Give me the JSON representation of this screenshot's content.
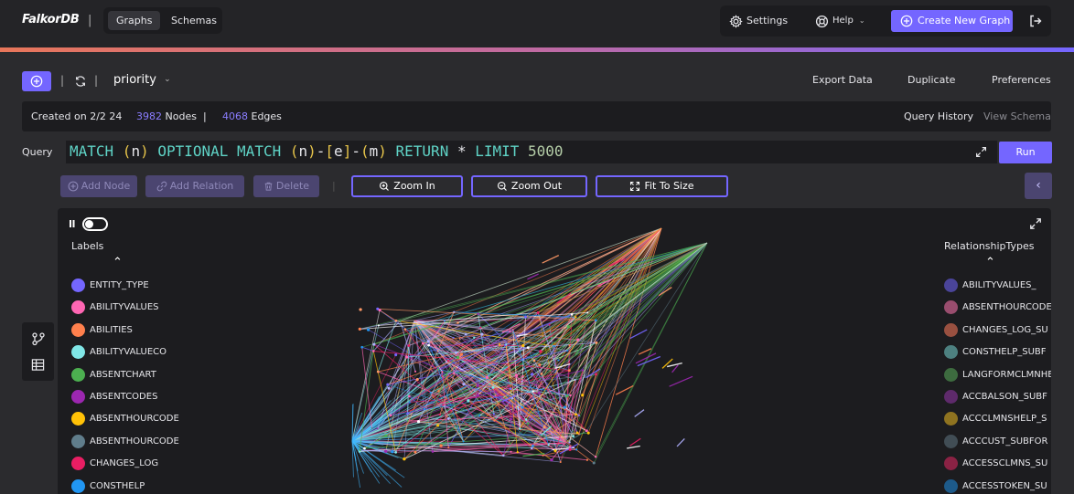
{
  "app": {
    "logo": "FalkorDB"
  },
  "nav": {
    "tabs": [
      {
        "label": "Graphs",
        "active": true
      },
      {
        "label": "Schemas",
        "active": false
      }
    ],
    "settings_label": "Settings",
    "help_label": "Help",
    "create_label": "Create New Graph"
  },
  "graph": {
    "name": "priority",
    "export_label": "Export Data",
    "duplicate_label": "Duplicate",
    "preferences_label": "Preferences"
  },
  "info": {
    "created_label": "Created on 2/2 24",
    "nodes_count": "3982",
    "nodes_label": "Nodes",
    "divider": "|",
    "edges_count": "4068",
    "edges_label": "Edges",
    "query_history_label": "Query History",
    "view_schema_label": "View Schema"
  },
  "query": {
    "label": "Query",
    "tokens": [
      {
        "t": "MATCH ",
        "c": "#5fd3c6"
      },
      {
        "t": "(",
        "c": "#e6c44a"
      },
      {
        "t": "n",
        "c": "#e6e6ea"
      },
      {
        "t": ")",
        "c": "#e6c44a"
      },
      {
        "t": " OPTIONAL MATCH ",
        "c": "#5fd3c6"
      },
      {
        "t": "(",
        "c": "#e6c44a"
      },
      {
        "t": "n",
        "c": "#e6e6ea"
      },
      {
        "t": ")",
        "c": "#e6c44a"
      },
      {
        "t": "-",
        "c": "#e6e6ea"
      },
      {
        "t": "[",
        "c": "#e6c44a"
      },
      {
        "t": "e",
        "c": "#e6e6ea"
      },
      {
        "t": "]",
        "c": "#e6c44a"
      },
      {
        "t": "-",
        "c": "#e6e6ea"
      },
      {
        "t": "(",
        "c": "#e6c44a"
      },
      {
        "t": "m",
        "c": "#e6e6ea"
      },
      {
        "t": ")",
        "c": "#e6c44a"
      },
      {
        "t": " RETURN ",
        "c": "#5fd3c6"
      },
      {
        "t": "* ",
        "c": "#e6e6ea"
      },
      {
        "t": "LIMIT ",
        "c": "#5fd3c6"
      },
      {
        "t": "5000",
        "c": "#b5cea8"
      }
    ],
    "run_label": "Run"
  },
  "actions": {
    "add_node": "Add Node",
    "add_relation": "Add Relation",
    "delete": "Delete",
    "zoom_in": "Zoom In",
    "zoom_out": "Zoom Out",
    "fit": "Fit To Size"
  },
  "legend": {
    "labels_title": "Labels",
    "labels": [
      {
        "name": "ENTITY_TYPE",
        "color": "#7466ff"
      },
      {
        "name": "ABILITYVALUES",
        "color": "#ff66b3"
      },
      {
        "name": "ABILITIES",
        "color": "#ff804d"
      },
      {
        "name": "ABILITYVALUECO",
        "color": "#80e6e6"
      },
      {
        "name": "ABSENTCHART",
        "color": "#4caf50"
      },
      {
        "name": "ABSENTCODES",
        "color": "#9c27b0"
      },
      {
        "name": "ABSENTHOURCODE",
        "color": "#ffc107"
      },
      {
        "name": "ABSENTHOURCODE",
        "color": "#607d8b"
      },
      {
        "name": "CHANGES_LOG",
        "color": "#e91e63"
      },
      {
        "name": "CONSTHELP",
        "color": "#2196f3"
      }
    ],
    "relationships_title": "RelationshipTypes",
    "relationships": [
      {
        "name": "ABILITYVALUES_",
        "color": "#4a4499"
      },
      {
        "name": "ABSENTHOURCODE",
        "color": "#994d6e"
      },
      {
        "name": "CHANGES_LOG_SU",
        "color": "#995040"
      },
      {
        "name": "CONSTHELP_SUBF",
        "color": "#4d8080"
      },
      {
        "name": "LANGFORMCLMNHE",
        "color": "#3d6b3f"
      },
      {
        "name": "ACCBALSON_SUBF",
        "color": "#5e2a6b"
      },
      {
        "name": "ACCCLMNSHELP_S",
        "color": "#8f7320"
      },
      {
        "name": "ACCCUST_SUBFOR",
        "color": "#414d55"
      },
      {
        "name": "ACCESSCLMNS_SU",
        "color": "#8a2244"
      },
      {
        "name": "ACCESSTOKEN_SU",
        "color": "#1d5a8a"
      }
    ]
  },
  "colors": {
    "accent": "#7466ff",
    "bg": "#2b2b2e",
    "panel": "#1c1c1f"
  }
}
